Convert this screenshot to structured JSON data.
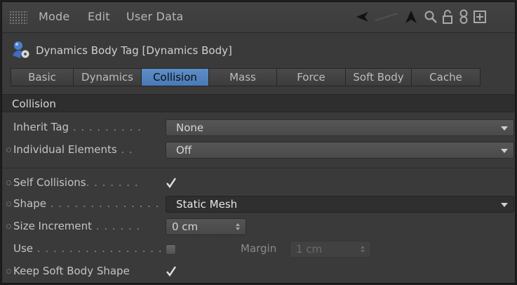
{
  "menubar": {
    "items": [
      "Mode",
      "Edit",
      "User Data"
    ],
    "icons": [
      "back-arrow-icon",
      "up-arrow-icon",
      "search-icon",
      "lock-icon",
      "link-icon",
      "new-panel-icon"
    ]
  },
  "tag": {
    "icon": "dynamics-body-tag-icon",
    "title": "Dynamics Body Tag [Dynamics Body]"
  },
  "tabs": [
    {
      "label": "Basic",
      "active": false
    },
    {
      "label": "Dynamics",
      "active": false
    },
    {
      "label": "Collision",
      "active": true
    },
    {
      "label": "Mass",
      "active": false
    },
    {
      "label": "Force",
      "active": false
    },
    {
      "label": "Soft Body",
      "active": false
    },
    {
      "label": "Cache",
      "active": false
    }
  ],
  "section": {
    "title": "Collision"
  },
  "fields": {
    "inherit_tag": {
      "label": "Inherit Tag",
      "leader": " . . . . . . . . .",
      "value": "None"
    },
    "individual_elements": {
      "label": "Individual Elements",
      "leader": " . .",
      "value": "Off"
    },
    "self_collisions": {
      "label": "Self Collisions",
      "leader": ". . . . . . .",
      "checked": true
    },
    "shape": {
      "label": "Shape",
      "leader": " . . . . . . . . . . . . . .",
      "value": "Static Mesh"
    },
    "size_increment": {
      "label": "Size Increment",
      "leader": " . . . . . .",
      "value": "0 cm"
    },
    "use": {
      "label": "Use",
      "leader": " . . . . . . . . . . . . . . . .",
      "checked": false
    },
    "margin": {
      "label": "Margin",
      "value": "1 cm"
    },
    "keep_soft_body_shape": {
      "label": "Keep Soft Body Shape",
      "checked": true
    }
  },
  "colors": {
    "panel": "#3a3a3a",
    "active_tab": "#5e8ec8",
    "section_bar": "#2e2e2e",
    "dropdown": "#505050"
  }
}
